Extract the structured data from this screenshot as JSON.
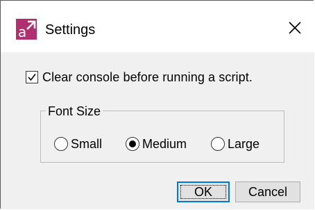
{
  "window": {
    "title": "Settings"
  },
  "icons": {
    "app": "app-logo-icon",
    "close": "close-icon",
    "check": "checkmark-icon"
  },
  "options": {
    "clear_console": {
      "label": "Clear console before running a script.",
      "checked": true
    }
  },
  "font_size": {
    "legend": "Font Size",
    "choices": [
      {
        "label": "Small",
        "selected": false
      },
      {
        "label": "Medium",
        "selected": true
      },
      {
        "label": "Large",
        "selected": false
      }
    ]
  },
  "buttons": {
    "ok": "OK",
    "cancel": "Cancel"
  },
  "colors": {
    "focus_border": "#0078d7",
    "icon_primary": "#b0306f"
  }
}
